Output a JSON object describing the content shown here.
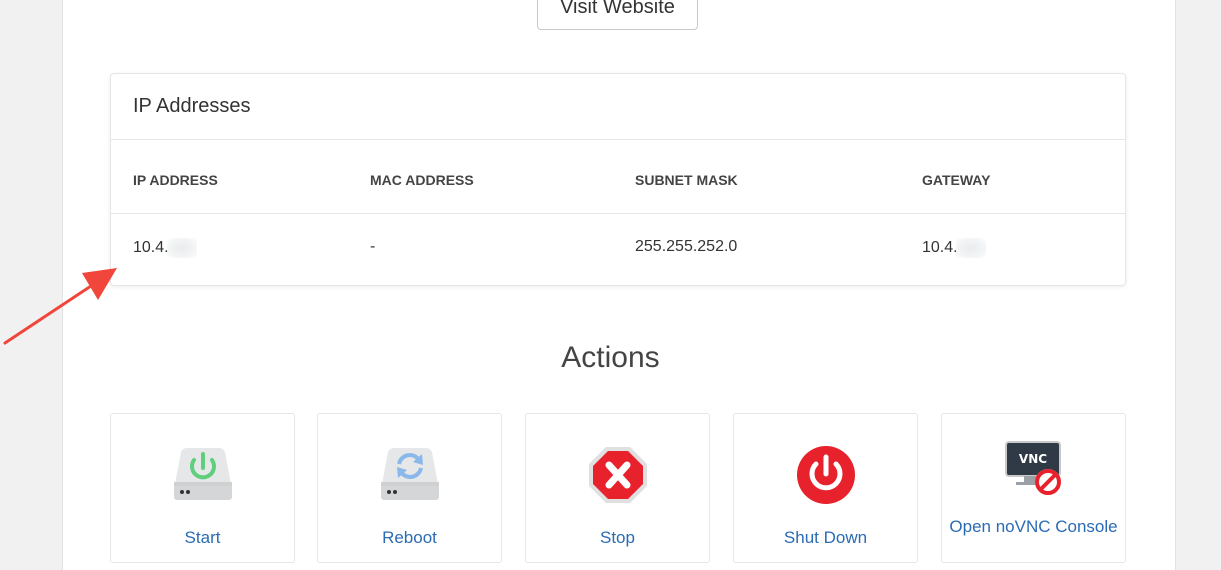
{
  "visit_button": {
    "label": "Visit Website"
  },
  "ip_card": {
    "title": "IP Addresses",
    "columns": [
      "IP ADDRESS",
      "MAC ADDRESS",
      "SUBNET MASK",
      "GATEWAY"
    ],
    "row": {
      "ip": "10.4.",
      "mac": "-",
      "subnet": "255.255.252.0",
      "gateway": "10.4."
    }
  },
  "actions": {
    "title": "Actions",
    "items": [
      {
        "label": "Start",
        "icon": "server-power-icon"
      },
      {
        "label": "Reboot",
        "icon": "server-refresh-icon"
      },
      {
        "label": "Stop",
        "icon": "stop-octagon-icon"
      },
      {
        "label": "Shut Down",
        "icon": "power-circle-icon"
      },
      {
        "label": "Open noVNC Console",
        "icon": "vnc-disabled-icon"
      }
    ]
  },
  "colors": {
    "link": "#2a6bb5",
    "stop_red": "#e8222c",
    "annotation_arrow": "#f0463c"
  }
}
